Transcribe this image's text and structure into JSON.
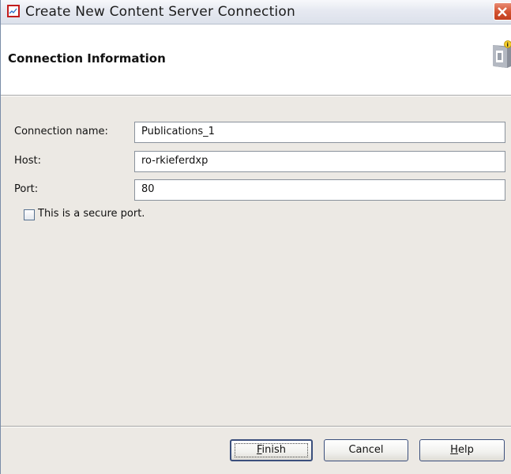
{
  "window": {
    "title": "Create New Content Server Connection",
    "icons": {
      "app": "chart-app-icon",
      "close": "close-icon"
    },
    "colors": {
      "close_button": "#d2512f",
      "app_icon_border": "#c21d1d"
    }
  },
  "banner": {
    "title": "Connection Information",
    "icon": "server-info-icon"
  },
  "form": {
    "connection_name": {
      "label": "Connection name:",
      "value": "Publications_1"
    },
    "host": {
      "label": "Host:",
      "value": "ro-rkieferdxp"
    },
    "port": {
      "label": "Port:",
      "value": "80"
    },
    "secure_port": {
      "label": "This is a secure port.",
      "checked": false
    }
  },
  "buttons": {
    "finish": {
      "mnemonic": "F",
      "rest": "inish"
    },
    "cancel": {
      "label": "Cancel"
    },
    "help": {
      "mnemonic": "H",
      "rest": "elp"
    }
  }
}
